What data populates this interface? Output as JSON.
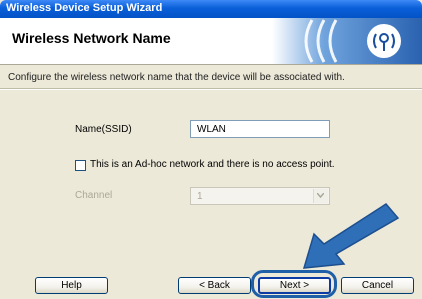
{
  "window": {
    "title": "Wireless Device Setup Wizard"
  },
  "header": {
    "title": "Wireless Network Name"
  },
  "instruction": "Configure the wireless network name that the device will be associated with.",
  "form": {
    "ssid_label": "Name(SSID)",
    "ssid_value": "WLAN",
    "adhoc_checked": false,
    "adhoc_label": "This is an Ad-hoc network and there is no access point.",
    "channel_label": "Channel",
    "channel_value": "1"
  },
  "buttons": {
    "help": "Help",
    "back": "< Back",
    "next": "Next >",
    "cancel": "Cancel"
  },
  "colors": {
    "title_bar": "#0a5fd8",
    "highlight": "#1e5fa8",
    "arrow": "#2e6fb8",
    "background": "#ece9d8"
  },
  "icons": {
    "banner": "wireless-signal-banner",
    "arrow": "pointing-arrow"
  }
}
